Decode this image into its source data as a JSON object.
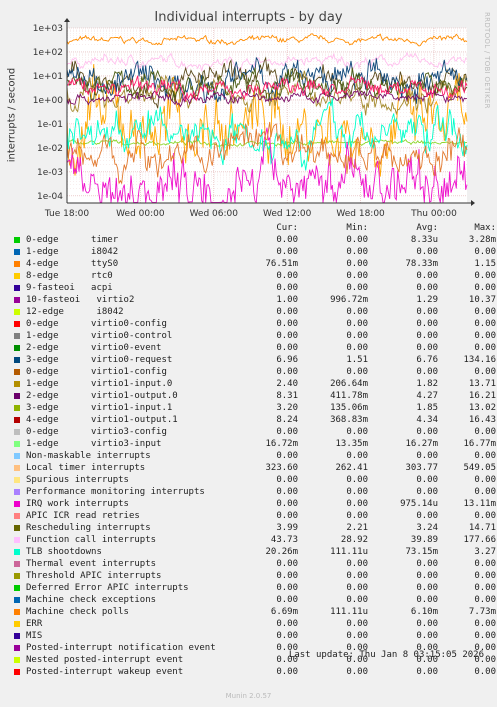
{
  "chart_data": {
    "type": "line",
    "title": "Individual interrupts - by day",
    "ylabel": "interrupts / second",
    "y_scale": "log",
    "ylim": [
      5e-05,
      1000
    ],
    "yticks": [
      {
        "value": 1000,
        "label": "1e+03"
      },
      {
        "value": 100,
        "label": "1e+02"
      },
      {
        "value": 10,
        "label": "1e+01"
      },
      {
        "value": 1,
        "label": "1e+00"
      },
      {
        "value": 0.1,
        "label": "1e-01"
      },
      {
        "value": 0.01,
        "label": "1e-02"
      },
      {
        "value": 0.001,
        "label": "1e-03"
      },
      {
        "value": 0.0001,
        "label": "1e-04"
      }
    ],
    "xticks": [
      "Tue 18:00",
      "Wed 00:00",
      "Wed 06:00",
      "Wed 12:00",
      "Wed 18:00",
      "Thu 00:00"
    ],
    "grid": true,
    "series": [
      {
        "name": "Local timer interrupts",
        "color": "#FF8C00",
        "level": 300,
        "spread": 0.15
      },
      {
        "name": "Function call interrupts",
        "color": "#FFC0EE",
        "level": 40,
        "spread": 0.25
      },
      {
        "name": "virtio3-input",
        "color": "#8DD62D",
        "level": 0.016,
        "spread": 0.1
      },
      {
        "name": "ttyS0",
        "color": "#FFA500",
        "level": 0.08,
        "spread": 1.6
      },
      {
        "name": "virtio1-output.0",
        "color": "#5C4B1D",
        "level": 6,
        "spread": 0.55
      },
      {
        "name": "virtio0-request",
        "color": "#10487A",
        "level": 6.5,
        "spread": 0.75
      },
      {
        "name": "virtio1-input.0",
        "color": "#A58A2E",
        "level": 2,
        "spread": 0.6
      },
      {
        "name": "virtio1-output.1",
        "color": "#4C5D12",
        "level": 4,
        "spread": 0.6
      },
      {
        "name": "virtio2",
        "color": "#7B0F68",
        "level": 1.2,
        "spread": 0.25
      },
      {
        "name": "Rescheduling interrupts",
        "color": "#FF1F6B",
        "level": 3.2,
        "spread": 0.4
      },
      {
        "name": "TLB shootdowns",
        "color": "#00FFCC",
        "level": 0.05,
        "spread": 0.9
      },
      {
        "name": "IRQ work interrupts",
        "color": "#EE11CC",
        "level": 0.0005,
        "spread": 1.3
      },
      {
        "name": "Machine check polls",
        "color": "#E27A2F",
        "level": 0.006,
        "spread": 0.8
      }
    ]
  },
  "legend": {
    "headers": {
      "cur": "Cur:",
      "min": "Min:",
      "avg": "Avg:",
      "max": "Max:"
    },
    "rows": [
      {
        "name": "0-edge      timer",
        "color": "#00CC00",
        "cur": "0.00",
        "min": "0.00",
        "avg": "8.33u",
        "max": "3.28m"
      },
      {
        "name": "1-edge      i8042",
        "color": "#0066B3",
        "cur": "0.00",
        "min": "0.00",
        "avg": "0.00",
        "max": "0.00"
      },
      {
        "name": "4-edge      ttyS0",
        "color": "#FF8000",
        "cur": "76.51m",
        "min": "0.00",
        "avg": "78.33m",
        "max": "1.15"
      },
      {
        "name": "8-edge      rtc0",
        "color": "#FFCC00",
        "cur": "0.00",
        "min": "0.00",
        "avg": "0.00",
        "max": "0.00"
      },
      {
        "name": "9-fasteoi   acpi",
        "color": "#330099",
        "cur": "0.00",
        "min": "0.00",
        "avg": "0.00",
        "max": "0.00"
      },
      {
        "name": "10-fasteoi   virtio2",
        "color": "#990099",
        "cur": "1.00",
        "min": "996.72m",
        "avg": "1.29",
        "max": "10.37"
      },
      {
        "name": "12-edge      i8042",
        "color": "#CCFF00",
        "cur": "0.00",
        "min": "0.00",
        "avg": "0.00",
        "max": "0.00"
      },
      {
        "name": "0-edge      virtio0-config",
        "color": "#FF0000",
        "cur": "0.00",
        "min": "0.00",
        "avg": "0.00",
        "max": "0.00"
      },
      {
        "name": "1-edge      virtio0-control",
        "color": "#808080",
        "cur": "0.00",
        "min": "0.00",
        "avg": "0.00",
        "max": "0.00"
      },
      {
        "name": "2-edge      virtio0-event",
        "color": "#008F00",
        "cur": "0.00",
        "min": "0.00",
        "avg": "0.00",
        "max": "0.00"
      },
      {
        "name": "3-edge      virtio0-request",
        "color": "#00487D",
        "cur": "6.96",
        "min": "1.51",
        "avg": "6.76",
        "max": "134.16"
      },
      {
        "name": "0-edge      virtio1-config",
        "color": "#B35A00",
        "cur": "0.00",
        "min": "0.00",
        "avg": "0.00",
        "max": "0.00"
      },
      {
        "name": "1-edge      virtio1-input.0",
        "color": "#B38F00",
        "cur": "2.40",
        "min": "206.64m",
        "avg": "1.82",
        "max": "13.71"
      },
      {
        "name": "2-edge      virtio1-output.0",
        "color": "#6B006B",
        "cur": "8.31",
        "min": "411.78m",
        "avg": "4.27",
        "max": "16.21"
      },
      {
        "name": "3-edge      virtio1-input.1",
        "color": "#8FB300",
        "cur": "3.20",
        "min": "135.06m",
        "avg": "1.85",
        "max": "13.02"
      },
      {
        "name": "4-edge      virtio1-output.1",
        "color": "#B30000",
        "cur": "8.24",
        "min": "368.83m",
        "avg": "4.34",
        "max": "16.43"
      },
      {
        "name": "0-edge      virtio3-config",
        "color": "#BEBEBE",
        "cur": "0.00",
        "min": "0.00",
        "avg": "0.00",
        "max": "0.00"
      },
      {
        "name": "1-edge      virtio3-input",
        "color": "#80FF80",
        "cur": "16.72m",
        "min": "13.35m",
        "avg": "16.27m",
        "max": "16.77m"
      },
      {
        "name": "Non-maskable interrupts",
        "color": "#80C9FF",
        "cur": "0.00",
        "min": "0.00",
        "avg": "0.00",
        "max": "0.00"
      },
      {
        "name": "Local timer interrupts",
        "color": "#FFC080",
        "cur": "323.60",
        "min": "262.41",
        "avg": "303.77",
        "max": "549.05"
      },
      {
        "name": "Spurious interrupts",
        "color": "#FFE680",
        "cur": "0.00",
        "min": "0.00",
        "avg": "0.00",
        "max": "0.00"
      },
      {
        "name": "Performance monitoring interrupts",
        "color": "#AA80FF",
        "cur": "0.00",
        "min": "0.00",
        "avg": "0.00",
        "max": "0.00"
      },
      {
        "name": "IRQ work interrupts",
        "color": "#EE00CC",
        "cur": "0.00",
        "min": "0.00",
        "avg": "975.14u",
        "max": "13.11m"
      },
      {
        "name": "APIC ICR read retries",
        "color": "#FF8080",
        "cur": "0.00",
        "min": "0.00",
        "avg": "0.00",
        "max": "0.00"
      },
      {
        "name": "Rescheduling interrupts",
        "color": "#666600",
        "cur": "3.99",
        "min": "2.21",
        "avg": "3.24",
        "max": "14.71"
      },
      {
        "name": "Function call interrupts",
        "color": "#FFBFFF",
        "cur": "43.73",
        "min": "28.92",
        "avg": "39.89",
        "max": "177.66"
      },
      {
        "name": "TLB shootdowns",
        "color": "#00FFCC",
        "cur": "20.26m",
        "min": "111.11u",
        "avg": "73.15m",
        "max": "3.27"
      },
      {
        "name": "Thermal event interrupts",
        "color": "#CC6699",
        "cur": "0.00",
        "min": "0.00",
        "avg": "0.00",
        "max": "0.00"
      },
      {
        "name": "Threshold APIC interrupts",
        "color": "#999900",
        "cur": "0.00",
        "min": "0.00",
        "avg": "0.00",
        "max": "0.00"
      },
      {
        "name": "Deferred Error APIC interrupts",
        "color": "#00CC00",
        "cur": "0.00",
        "min": "0.00",
        "avg": "0.00",
        "max": "0.00"
      },
      {
        "name": "Machine check exceptions",
        "color": "#0066B3",
        "cur": "0.00",
        "min": "0.00",
        "avg": "0.00",
        "max": "0.00"
      },
      {
        "name": "Machine check polls",
        "color": "#FF8000",
        "cur": "6.69m",
        "min": "111.11u",
        "avg": "6.10m",
        "max": "7.73m"
      },
      {
        "name": "ERR",
        "color": "#FFCC00",
        "cur": "0.00",
        "min": "0.00",
        "avg": "0.00",
        "max": "0.00"
      },
      {
        "name": "MIS",
        "color": "#330099",
        "cur": "0.00",
        "min": "0.00",
        "avg": "0.00",
        "max": "0.00"
      },
      {
        "name": "Posted-interrupt notification event",
        "color": "#990099",
        "cur": "0.00",
        "min": "0.00",
        "avg": "0.00",
        "max": "0.00"
      },
      {
        "name": "Nested posted-interrupt event",
        "color": "#CCFF00",
        "cur": "0.00",
        "min": "0.00",
        "avg": "0.00",
        "max": "0.00"
      },
      {
        "name": "Posted-interrupt wakeup event",
        "color": "#FF0000",
        "cur": "0.00",
        "min": "0.00",
        "avg": "0.00",
        "max": "0.00"
      }
    ]
  },
  "footer": "Last update: Thu Jan  8 03:15:05 2026",
  "side_note": "RRDTOOL / TOBI OETIKER",
  "brand": "Munin 2.0.57"
}
